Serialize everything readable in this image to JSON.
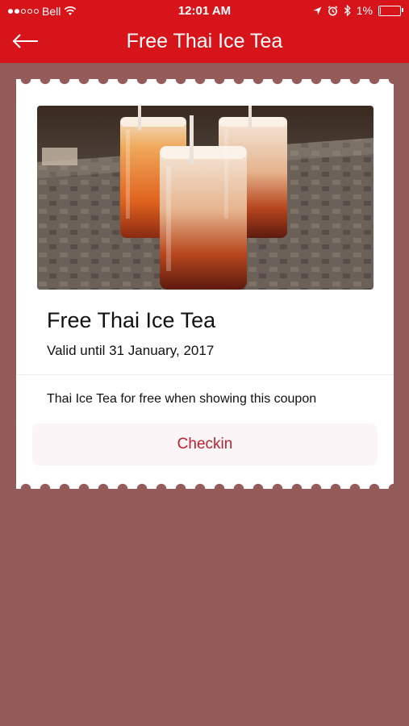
{
  "status_bar": {
    "carrier": "Bell",
    "time": "12:01 AM",
    "battery": "1%",
    "signal_icon": "signal-dots-icon",
    "wifi_icon": "wifi-icon",
    "location_icon": "location-arrow-icon",
    "alarm_icon": "alarm-icon",
    "bluetooth_icon": "bluetooth-icon"
  },
  "nav": {
    "title": "Free Thai Ice Tea",
    "back_icon": "back-arrow-icon"
  },
  "coupon": {
    "image": "thai-iced-tea-photo",
    "title": "Free Thai Ice Tea",
    "valid_text": "Valid until 31 January, 2017",
    "description": "Thai Ice Tea for free when showing this coupon",
    "checkin_label": "Checkin"
  },
  "colors": {
    "nav_bg": "#d8141b",
    "page_bg": "#945b5b",
    "checkin_text": "#bf222d",
    "checkin_bg": "#fbf5f8"
  }
}
